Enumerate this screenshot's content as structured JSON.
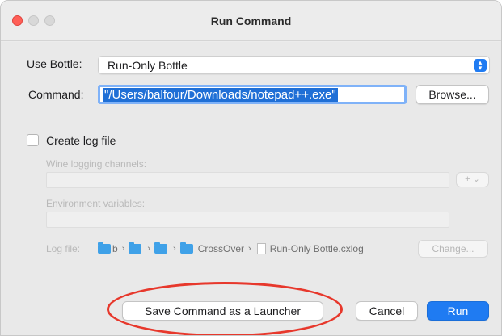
{
  "window": {
    "title": "Run Command"
  },
  "form": {
    "bottle_label": "Use Bottle:",
    "bottle_value": "Run-Only Bottle",
    "command_label": "Command:",
    "command_value": "\"/Users/balfour/Downloads/notepad++.exe\"",
    "browse_label": "Browse...",
    "create_log_label": "Create log file",
    "create_log_checked": false,
    "wine_channels_label": "Wine logging channels:",
    "wine_channels_value": "",
    "add_channel_label": "+ ⌄",
    "env_vars_label": "Environment variables:",
    "env_vars_value": "",
    "log_file_label": "Log file:",
    "log_path": [
      "b",
      "",
      "",
      "CrossOver",
      "Run-Only Bottle.cxlog"
    ],
    "change_label": "Change..."
  },
  "buttons": {
    "save_launcher_label": "Save Command as a Launcher",
    "cancel_label": "Cancel",
    "run_label": "Run"
  },
  "colors": {
    "accent": "#1f7bf2",
    "annotation": "#e7382c",
    "close": "#ff5f57"
  }
}
